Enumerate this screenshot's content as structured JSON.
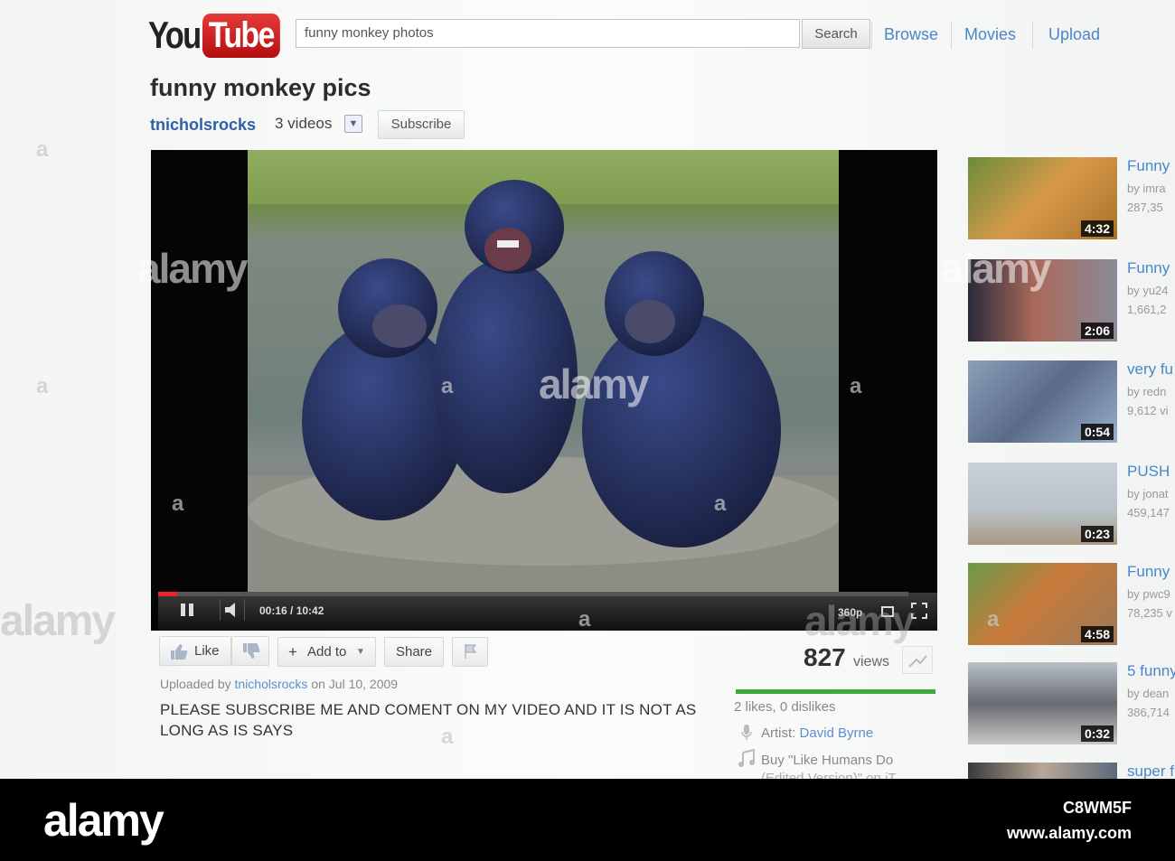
{
  "header": {
    "logo_you": "You",
    "logo_tube": "Tube",
    "search_value": "funny monkey photos",
    "search_button": "Search",
    "nav": [
      "Browse",
      "Movies",
      "Upload"
    ]
  },
  "video": {
    "title": "funny monkey pics",
    "channel": "tnicholsrocks",
    "channel_videos": "3 videos",
    "subscribe_label": "Subscribe",
    "time_current": "00:16",
    "time_total": "10:42",
    "time_display": "00:16 / 10:42",
    "quality": "360p",
    "progress": 0.025
  },
  "actions": {
    "like": "Like",
    "add_to": "Add to",
    "share": "Share",
    "views": "827",
    "views_label": "views",
    "likes_text": "2 likes, 0 dislikes",
    "artist_label": "Artist:",
    "artist_name": "David Byrne",
    "buy_text": "Buy \"Like Humans Do",
    "buy_text_2": "(Edited Version)\" on iT..."
  },
  "upload": {
    "prefix": "Uploaded by",
    "user": "tnicholsrocks",
    "date": "on Jul 10, 2009",
    "description": "PLEASE SUBSCRIBE ME AND COMENT ON MY VIDEO AND IT IS NOT AS LONG AS IS SAYS"
  },
  "related": [
    {
      "title": "Funny",
      "by": "by imra",
      "views": "287,35",
      "duration": "4:32"
    },
    {
      "title": "Funny",
      "by": "by yu24",
      "views": "1,661,2",
      "duration": "2:06"
    },
    {
      "title": "very fu",
      "by": "by redn",
      "views": "9,612 vi",
      "duration": "0:54"
    },
    {
      "title": "PUSH",
      "by": "by jonat",
      "views": "459,147",
      "duration": "0:23"
    },
    {
      "title": "Funny",
      "by": "by pwc9",
      "views": "78,235 v",
      "duration": "4:58"
    },
    {
      "title": "5 funny",
      "by": "by dean",
      "views": "386,714",
      "duration": "0:32"
    },
    {
      "title": "super f",
      "by": "",
      "views": "",
      "duration": ""
    }
  ],
  "watermark": {
    "brand": "alamy",
    "image_id": "C8WM5F",
    "site": "www.alamy.com"
  },
  "colors": {
    "link": "#4a86c8",
    "likebar": "#3caa3c",
    "progress": "#e22233",
    "logo_red": "#cc1a1a"
  }
}
